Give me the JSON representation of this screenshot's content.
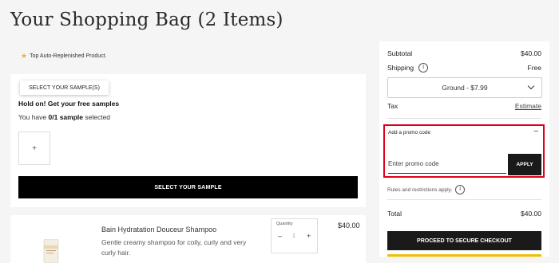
{
  "page": {
    "title": "Your Shopping Bag (2 Items)",
    "auto_note": "Top Auto-Replenished Product."
  },
  "samples": {
    "tab_label": "SELECT YOUR SAMPLE(S)",
    "hold_text": "Hold on! Get your free samples",
    "have_prefix": "You have ",
    "have_count": "0/1",
    "have_unit": "sample",
    "have_suffix": " selected",
    "add_symbol": "+",
    "select_button": "SELECT YOUR SAMPLE"
  },
  "product": {
    "name": "Bain Hydratation Douceur Shampoo",
    "description": "Gentle creamy shampoo for coily, curly and very curly hair.",
    "quantity_label": "Quantity",
    "quantity_value": "1",
    "minus": "–",
    "plus": "+",
    "price": "$40.00"
  },
  "summary": {
    "subtotal_label": "Subtotal",
    "subtotal_value": "$40.00",
    "shipping_label": "Shipping",
    "shipping_value": "Free",
    "shipping_option": "Ground - $7.99",
    "tax_label": "Tax",
    "tax_link": "Estimate",
    "promo_label": "Add a promo code",
    "promo_toggle": "–",
    "promo_placeholder": "Enter promo code",
    "apply_button": "APPLY",
    "rules_text": "Rules and restrictions apply.",
    "total_label": "Total",
    "total_value": "$40.00",
    "checkout_button": "PROCEED TO SECURE CHECKOUT",
    "info_symbol": "i"
  },
  "colors": {
    "background": "#f5f5f5",
    "primary_button": "#000000",
    "highlight_border": "#e0001b",
    "star": "#f1b51c",
    "accent_bar": "#f0c000"
  },
  "icons": {
    "star": "star-icon",
    "info": "info-icon",
    "chevron": "chevron-down-icon"
  }
}
